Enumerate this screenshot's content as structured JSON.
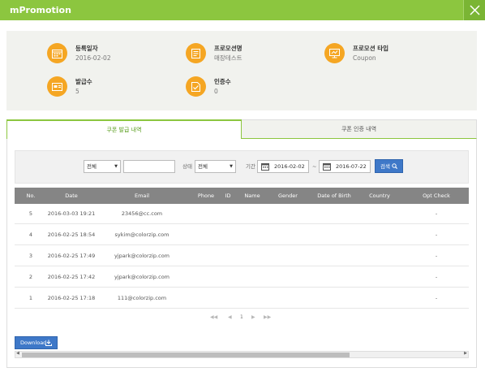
{
  "window": {
    "title": "mPromotion"
  },
  "info": {
    "reg_date_label": "등록일자",
    "reg_date_value": "2016-02-02",
    "promo_name_label": "프로모션명",
    "promo_name_value": "매장테스트",
    "promo_type_label": "프로모션 타입",
    "promo_type_value": "Coupon",
    "issued_label": "발급수",
    "issued_value": "5",
    "verified_label": "인증수",
    "verified_value": "0"
  },
  "tabs": [
    {
      "label": "쿠폰 발급 내역"
    },
    {
      "label": "쿠폰 인증 내역"
    }
  ],
  "filter": {
    "type_value": "전체",
    "keyword_value": "",
    "status_label": "상태",
    "status_value": "전체",
    "period_label": "기간",
    "start_date": "2016-02-02",
    "tilde": "~",
    "end_date": "2016-07-22",
    "search_label": "검색"
  },
  "table": {
    "columns": [
      "No.",
      "Date",
      "Email",
      "Phone",
      "ID",
      "Name",
      "Gender",
      "Date of Birth",
      "Country",
      "Opt Check"
    ],
    "rows": [
      {
        "no": "5",
        "date": "2016-03-03 19:21",
        "email": "23456@cc.com",
        "opt": "-"
      },
      {
        "no": "4",
        "date": "2016-02-25 18:54",
        "email": "sykim@colorzip.com",
        "opt": "-"
      },
      {
        "no": "3",
        "date": "2016-02-25 17:49",
        "email": "yjpark@colorzip.com",
        "opt": "-"
      },
      {
        "no": "2",
        "date": "2016-02-25 17:42",
        "email": "yjpark@colorzip.com",
        "opt": "-"
      },
      {
        "no": "1",
        "date": "2016-02-25 17:18",
        "email": "111@colorzip.com",
        "opt": "-"
      }
    ]
  },
  "pager": {
    "first": "◀◀",
    "prev": "◀",
    "page": "1",
    "next": "▶",
    "last": "▶▶"
  },
  "download": {
    "label": "Download"
  },
  "colors": {
    "header": "#8cc63f",
    "accent": "#f5a623",
    "button": "#3e78c8",
    "table_header": "#858585"
  }
}
